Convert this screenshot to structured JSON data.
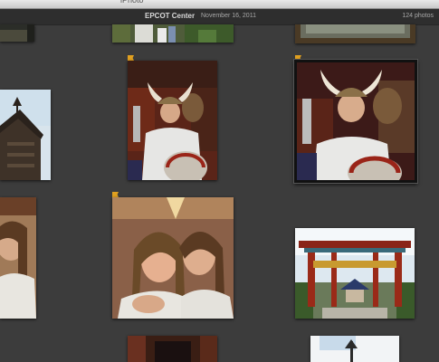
{
  "app": {
    "title": "iPhoto"
  },
  "event": {
    "title": "EPCOT Center",
    "date": "November 16, 2011",
    "photo_count": "124 photos"
  },
  "colors": {
    "background": "#3c3c3c",
    "flag": "#e0a020"
  }
}
